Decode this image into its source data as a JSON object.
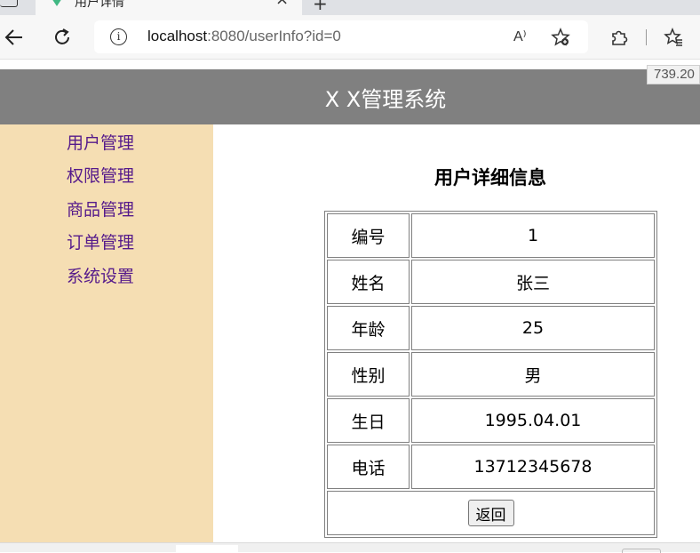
{
  "browser": {
    "tab_title": "用户详情",
    "tab_close": "×",
    "new_tab": "+",
    "url_host": "localhost",
    "url_rest": ":8080/userInfo?id=0",
    "read_aloud": "A⁾"
  },
  "viewport_readout": "739.20",
  "header": {
    "title": "X X管理系统"
  },
  "sidebar": {
    "items": [
      {
        "label": "用户管理"
      },
      {
        "label": "权限管理"
      },
      {
        "label": "商品管理"
      },
      {
        "label": "订单管理"
      },
      {
        "label": "系统设置"
      }
    ]
  },
  "main": {
    "title": "用户详细信息",
    "rows": [
      {
        "label": "编号",
        "value": "1"
      },
      {
        "label": "姓名",
        "value": "张三"
      },
      {
        "label": "年龄",
        "value": "25"
      },
      {
        "label": "性别",
        "value": "男"
      },
      {
        "label": "生日",
        "value": "1995.04.01"
      },
      {
        "label": "电话",
        "value": "13712345678"
      }
    ],
    "back_label": "返回"
  },
  "colors": {
    "header_bg": "#808080",
    "sidebar_bg": "#f5deb3",
    "link_visited": "#551a8b"
  }
}
